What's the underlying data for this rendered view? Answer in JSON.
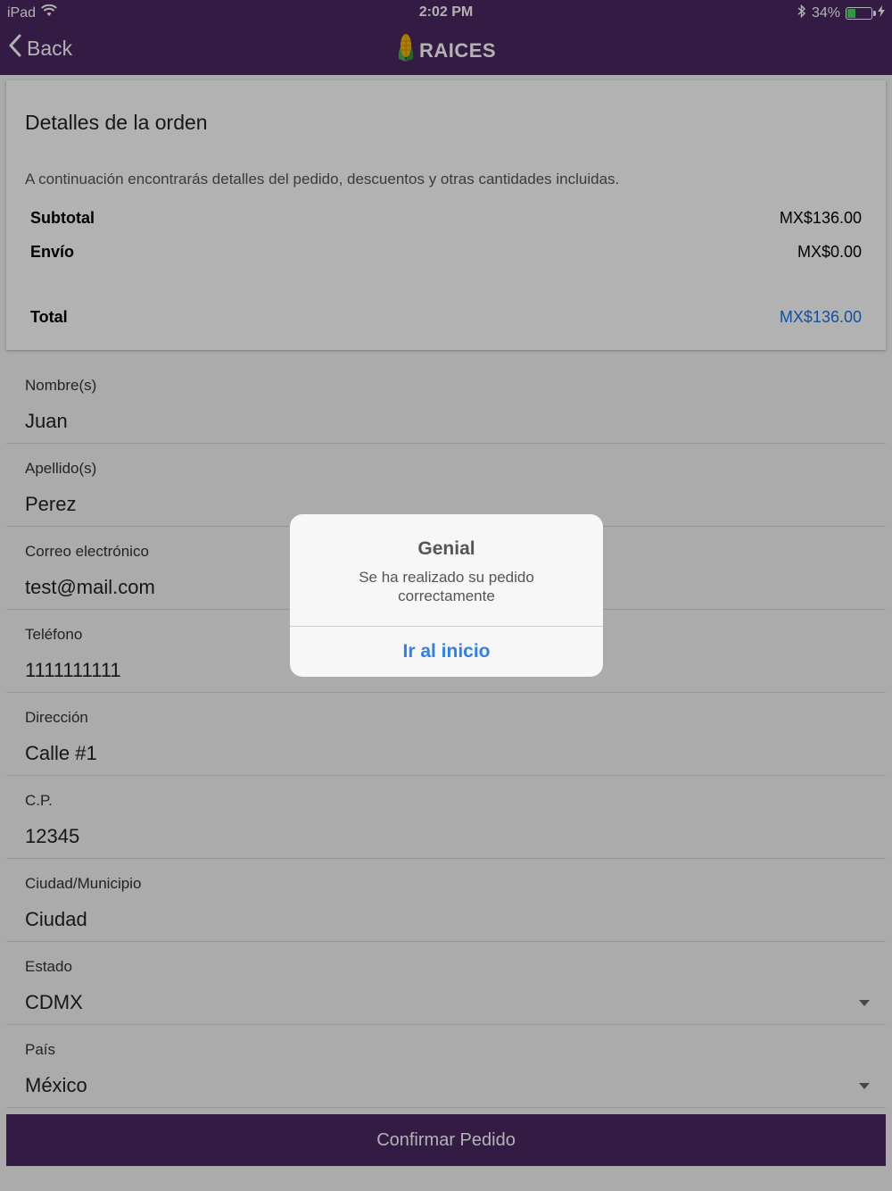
{
  "status_bar": {
    "device": "iPad",
    "time": "2:02 PM",
    "battery": "34%"
  },
  "nav": {
    "back_label": "Back",
    "brand": "RAICES"
  },
  "order_details": {
    "title": "Detalles de la orden",
    "description": "A continuación encontrarás detalles del pedido, descuentos y otras cantidades incluidas.",
    "rows": [
      {
        "label": "Subtotal",
        "value": "MX$136.00"
      },
      {
        "label": "Envío",
        "value": "MX$0.00"
      },
      {
        "label": "Total",
        "value": "MX$136.00"
      }
    ]
  },
  "form": {
    "fields": [
      {
        "label": "Nombre(s)",
        "value": "Juan"
      },
      {
        "label": "Apellido(s)",
        "value": "Perez"
      },
      {
        "label": "Correo electrónico",
        "value": "test@mail.com"
      },
      {
        "label": "Teléfono",
        "value": "1111111111"
      },
      {
        "label": "Dirección",
        "value": "Calle #1"
      },
      {
        "label": "C.P.",
        "value": "12345"
      },
      {
        "label": "Ciudad/Municipio",
        "value": "Ciudad"
      },
      {
        "label": "Estado",
        "value": "CDMX"
      },
      {
        "label": "País",
        "value": "México"
      }
    ],
    "confirm_label": "Confirmar Pedido"
  },
  "dialog": {
    "title": "Genial",
    "message": "Se ha realizado su pedido correctamente",
    "button_label": "Ir al inicio"
  },
  "colors": {
    "brand_purple": "#4a2760",
    "link_blue": "#1a73e8",
    "dialog_button": "#2f7ef3"
  }
}
